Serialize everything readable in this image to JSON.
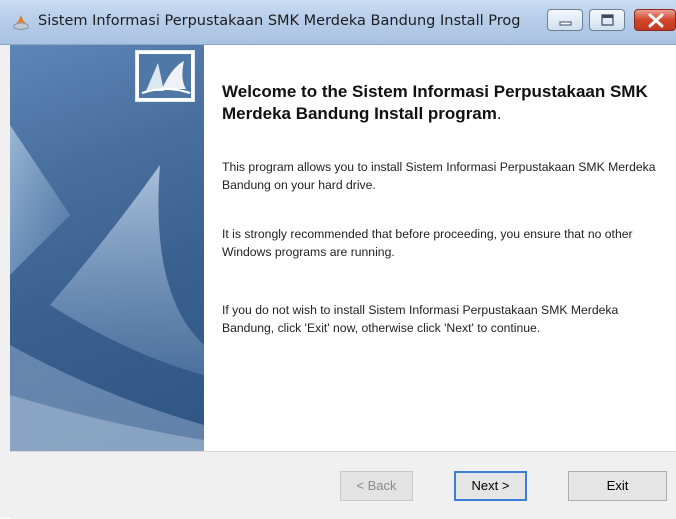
{
  "window": {
    "title": "Sistem Informasi Perpustakaan SMK Merdeka Bandung Install Prog",
    "icon": "installer-icon",
    "controls": [
      "minimize-icon",
      "maximize-icon",
      "close-icon"
    ]
  },
  "content": {
    "heading_main": "Welcome to the Sistem Informasi Perpustakaan SMK Merdeka Bandung Install program",
    "heading_end": ".",
    "paragraph1": "This program allows you to install Sistem Informasi Perpustakaan SMK Merdeka Bandung on your hard drive.",
    "paragraph2": "It is strongly recommended that before proceeding, you ensure that no other Windows programs are running.",
    "paragraph3": "If you do not wish to install Sistem Informasi Perpustakaan SMK Merdeka Bandung, click 'Exit' now, otherwise click 'Next' to continue."
  },
  "buttons": {
    "back": "< Back",
    "next": "Next >",
    "exit": "Exit"
  },
  "colors": {
    "side_panel": "#3a6090",
    "default_button_border": "#3c7fd6",
    "close_button": "#c13a22"
  }
}
